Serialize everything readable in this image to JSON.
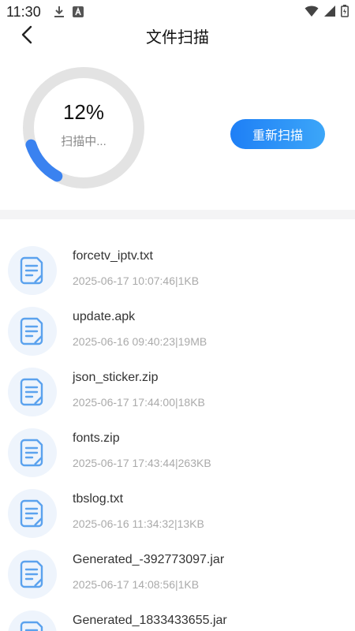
{
  "status_bar": {
    "time": "11:30",
    "icons": [
      "download-icon",
      "text-app-icon",
      "wifi-icon",
      "signal-icon",
      "battery-icon"
    ]
  },
  "header": {
    "title": "文件扫描",
    "back_icon": "chevron-left-icon"
  },
  "scan": {
    "percent": "12%",
    "progress_value": 0.12,
    "status_text": "扫描中...",
    "rescan_label": "重新扫描",
    "accent_color": "#3a82f0",
    "track_color": "#e3e3e3"
  },
  "files": [
    {
      "name": "forcetv_iptv.txt",
      "meta": "2025-06-17 10:07:46|1KB",
      "icon": "document-icon"
    },
    {
      "name": "update.apk",
      "meta": "2025-06-16 09:40:23|19MB",
      "icon": "document-icon"
    },
    {
      "name": "json_sticker.zip",
      "meta": "2025-06-17 17:44:00|18KB",
      "icon": "document-icon"
    },
    {
      "name": "fonts.zip",
      "meta": "2025-06-17 17:43:44|263KB",
      "icon": "document-icon"
    },
    {
      "name": "tbslog.txt",
      "meta": "2025-06-16 11:34:32|13KB",
      "icon": "document-icon"
    },
    {
      "name": "Generated_-392773097.jar",
      "meta": "2025-06-17 14:08:56|1KB",
      "icon": "document-icon"
    },
    {
      "name": "Generated_1833433655.jar",
      "meta": "",
      "icon": "document-icon"
    }
  ]
}
